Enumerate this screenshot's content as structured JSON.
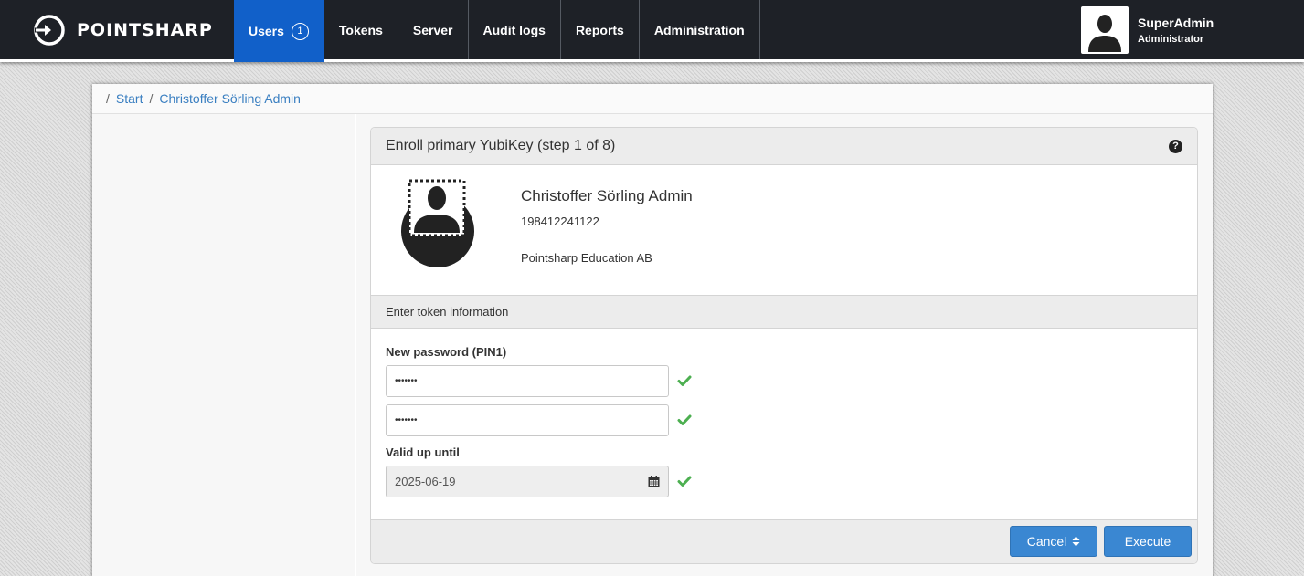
{
  "brand": {
    "name": "POINTSHARP"
  },
  "nav": {
    "items": [
      {
        "label": "Users",
        "badge": "1",
        "active": true
      },
      {
        "label": "Tokens"
      },
      {
        "label": "Server"
      },
      {
        "label": "Audit logs"
      },
      {
        "label": "Reports"
      },
      {
        "label": "Administration"
      }
    ]
  },
  "user": {
    "name": "SuperAdmin",
    "role": "Administrator"
  },
  "breadcrumb": {
    "sep": "/",
    "items": [
      "Start",
      "Christoffer Sörling Admin"
    ]
  },
  "card": {
    "title": "Enroll primary YubiKey (step 1 of 8)",
    "help_icon": "question-circle-icon",
    "person": {
      "name": "Christoffer Sörling Admin",
      "id": "198412241122",
      "org": "Pointsharp Education AB"
    },
    "section_title": "Enter token information",
    "form": {
      "password_label": "New password (PIN1)",
      "password_value": "•••••••",
      "password_confirm_value": "•••••••",
      "valid_label": "Valid up until",
      "valid_value": "2025-06-19"
    },
    "buttons": {
      "cancel": "Cancel",
      "execute": "Execute"
    }
  },
  "colors": {
    "nav_bg": "#1e2127",
    "nav_active": "#1160c9",
    "link": "#3a7fc1",
    "button": "#3a87d2",
    "check": "#4caf50"
  }
}
